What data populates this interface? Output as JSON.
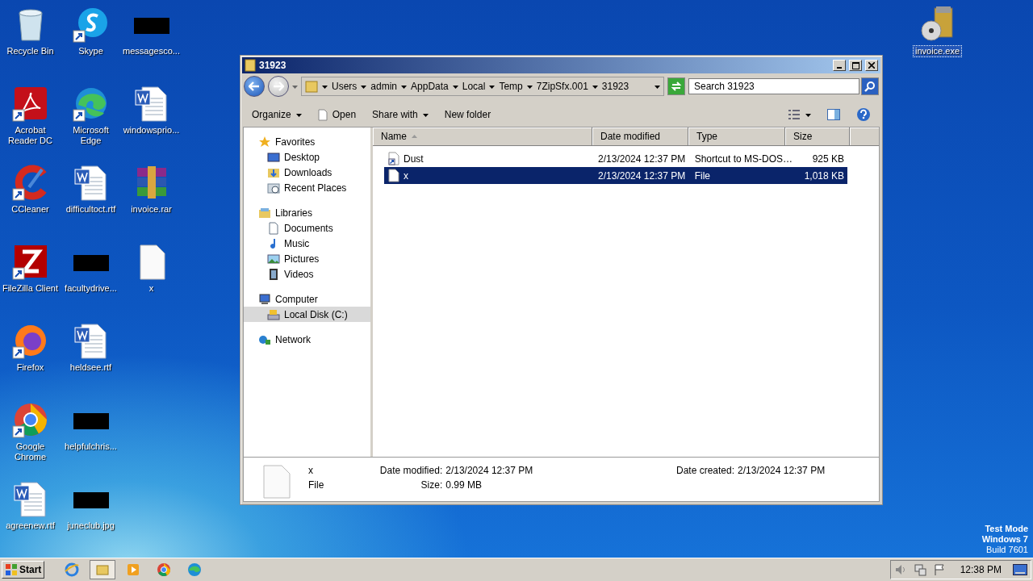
{
  "desktop": {
    "columns": [
      [
        {
          "label": "Recycle Bin",
          "kind": "recycle",
          "shortcut": false,
          "selected": false
        },
        {
          "label": "Acrobat Reader DC",
          "kind": "pdf",
          "shortcut": true,
          "selected": false
        },
        {
          "label": "CCleaner",
          "kind": "ccleaner",
          "shortcut": true,
          "selected": false
        },
        {
          "label": "FileZilla Client",
          "kind": "filezilla",
          "shortcut": true,
          "selected": false
        },
        {
          "label": "Firefox",
          "kind": "firefox",
          "shortcut": true,
          "selected": false
        },
        {
          "label": "Google Chrome",
          "kind": "chrome",
          "shortcut": true,
          "selected": false
        },
        {
          "label": "agreenew.rtf",
          "kind": "word",
          "shortcut": false,
          "selected": false
        }
      ],
      [
        {
          "label": "Skype",
          "kind": "skype",
          "shortcut": true,
          "selected": false
        },
        {
          "label": "Microsoft Edge",
          "kind": "edge",
          "shortcut": true,
          "selected": false
        },
        {
          "label": "difficultoct.rtf",
          "kind": "word",
          "shortcut": false,
          "selected": false
        },
        {
          "label": "facultydrive...",
          "kind": "thumb",
          "shortcut": false,
          "selected": false
        },
        {
          "label": "heldsee.rtf",
          "kind": "word",
          "shortcut": false,
          "selected": false
        },
        {
          "label": "helpfulchris...",
          "kind": "thumb",
          "shortcut": false,
          "selected": false
        },
        {
          "label": "juneclub.jpg",
          "kind": "thumb",
          "shortcut": false,
          "selected": false
        }
      ],
      [
        {
          "label": "messagesco...",
          "kind": "thumb",
          "shortcut": false,
          "selected": false
        },
        {
          "label": "windowsprio...",
          "kind": "word",
          "shortcut": false,
          "selected": false
        },
        {
          "label": "invoice.rar",
          "kind": "rar",
          "shortcut": false,
          "selected": false
        },
        {
          "label": "x",
          "kind": "file",
          "shortcut": false,
          "selected": false
        }
      ]
    ],
    "right_icons": [
      {
        "label": "invoice.exe",
        "kind": "exe",
        "shortcut": false,
        "selected": true
      }
    ]
  },
  "test_mode": {
    "title": "Test Mode",
    "edition": "Windows 7",
    "build": "Build 7601"
  },
  "window": {
    "title": "31923",
    "breadcrumb": [
      "Users",
      "admin",
      "AppData",
      "Local",
      "Temp",
      "7ZipSfx.001",
      "31923"
    ],
    "search": {
      "placeholder": "Search 31923"
    },
    "toolbar": [
      {
        "label": "Organize",
        "kind": "menu"
      },
      {
        "label": "Open",
        "kind": "icon"
      },
      {
        "label": "Share with",
        "kind": "menu"
      },
      {
        "label": "New folder",
        "kind": "plain"
      }
    ],
    "nav": [
      {
        "label": "Favorites",
        "selected": false,
        "children": [
          {
            "label": "Desktop",
            "selected": false
          },
          {
            "label": "Downloads",
            "selected": false
          },
          {
            "label": "Recent Places",
            "selected": false
          }
        ]
      },
      {
        "label": "Libraries",
        "selected": false,
        "children": [
          {
            "label": "Documents",
            "selected": false
          },
          {
            "label": "Music",
            "selected": false
          },
          {
            "label": "Pictures",
            "selected": false
          },
          {
            "label": "Videos",
            "selected": false
          }
        ]
      },
      {
        "label": "Computer",
        "selected": false,
        "children": [
          {
            "label": "Local Disk (C:)",
            "selected": true
          }
        ]
      },
      {
        "label": "Network",
        "selected": false
      }
    ],
    "columns": [
      {
        "label": "Name",
        "sorted": true
      },
      {
        "label": "Date modified",
        "sorted": false
      },
      {
        "label": "Type",
        "sorted": false
      },
      {
        "label": "Size",
        "sorted": false
      }
    ],
    "rows": [
      {
        "name": "Dust",
        "kind": "shortcut",
        "date": "2/13/2024 12:37 PM",
        "type": "Shortcut to MS-DOS…",
        "size": "925 KB",
        "selected": false
      },
      {
        "name": "x",
        "kind": "file",
        "date": "2/13/2024 12:37 PM",
        "type": "File",
        "size": "1,018 KB",
        "selected": true
      }
    ],
    "details": {
      "name": "x",
      "type": "File",
      "date_modified_label": "Date modified:",
      "date_modified": "2/13/2024 12:37 PM",
      "date_created_label": "Date created:",
      "date_created": "2/13/2024 12:37 PM",
      "size_label": "Size:",
      "size": "0.99 MB"
    }
  },
  "taskbar": {
    "start": "Start",
    "apps": [
      {
        "kind": "ie",
        "selected": false
      },
      {
        "kind": "explorer",
        "selected": true
      },
      {
        "kind": "media",
        "selected": false
      },
      {
        "kind": "chrome",
        "selected": false
      },
      {
        "kind": "edge",
        "selected": false
      }
    ],
    "clock": "12:38 PM"
  }
}
